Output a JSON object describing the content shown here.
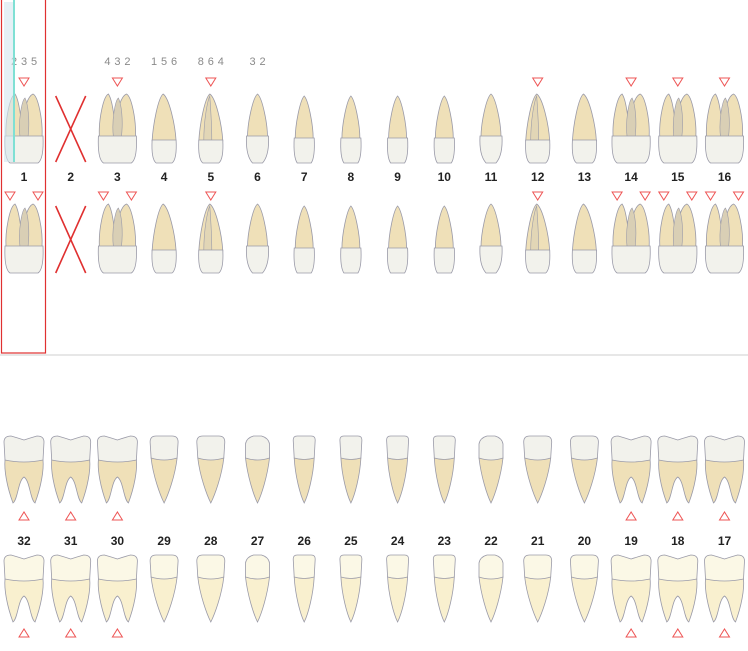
{
  "chart_title": "",
  "selected_tooth": "1",
  "missing_teeth": [
    "2"
  ],
  "colors": {
    "crown_fill": "#f2f2ec",
    "crown_fill_front": "#fbf8e6",
    "root_fill": "#efe0b8",
    "root_fill_light": "#f9f0cf",
    "outline": "#9a9aa8",
    "marker": "#ee5555",
    "missing_x": "#e03030",
    "selection": "#e03030",
    "probe_line": "#7fe0d4",
    "probe_fill": "#d3e6ee",
    "divider": "#cfcfcf",
    "probe_text": "#8a8a8a"
  },
  "upper_teeth": [
    {
      "number": "1",
      "type": "molar",
      "lingual_markers": 1,
      "buccal_markers": 2,
      "probing": [
        "2",
        "3",
        "5"
      ]
    },
    {
      "number": "2",
      "type": "molar",
      "lingual_markers": 0,
      "buccal_markers": 0,
      "probing": []
    },
    {
      "number": "3",
      "type": "molar",
      "lingual_markers": 1,
      "buccal_markers": 2,
      "probing": [
        "4",
        "3",
        "2"
      ]
    },
    {
      "number": "4",
      "type": "premolar",
      "lingual_markers": 0,
      "buccal_markers": 0,
      "probing": [
        "1",
        "5",
        "6"
      ]
    },
    {
      "number": "5",
      "type": "premolar2",
      "lingual_markers": 1,
      "buccal_markers": 1,
      "probing": [
        "8",
        "6",
        "4"
      ]
    },
    {
      "number": "6",
      "type": "canine",
      "lingual_markers": 0,
      "buccal_markers": 0,
      "probing": [
        "3",
        "2"
      ]
    },
    {
      "number": "7",
      "type": "incisor",
      "lingual_markers": 0,
      "buccal_markers": 0,
      "probing": []
    },
    {
      "number": "8",
      "type": "incisor",
      "lingual_markers": 0,
      "buccal_markers": 0,
      "probing": []
    },
    {
      "number": "9",
      "type": "incisor",
      "lingual_markers": 0,
      "buccal_markers": 0,
      "probing": []
    },
    {
      "number": "10",
      "type": "incisor",
      "lingual_markers": 0,
      "buccal_markers": 0,
      "probing": []
    },
    {
      "number": "11",
      "type": "canine",
      "lingual_markers": 0,
      "buccal_markers": 0,
      "probing": []
    },
    {
      "number": "12",
      "type": "premolar2",
      "lingual_markers": 1,
      "buccal_markers": 1,
      "probing": []
    },
    {
      "number": "13",
      "type": "premolar",
      "lingual_markers": 0,
      "buccal_markers": 0,
      "probing": []
    },
    {
      "number": "14",
      "type": "molar",
      "lingual_markers": 1,
      "buccal_markers": 2,
      "probing": []
    },
    {
      "number": "15",
      "type": "molar",
      "lingual_markers": 1,
      "buccal_markers": 2,
      "probing": []
    },
    {
      "number": "16",
      "type": "molar",
      "lingual_markers": 1,
      "buccal_markers": 2,
      "probing": []
    }
  ],
  "lower_teeth": [
    {
      "number": "32",
      "type": "molar",
      "lingual_markers": 1,
      "buccal_markers": 1
    },
    {
      "number": "31",
      "type": "molar",
      "lingual_markers": 1,
      "buccal_markers": 1
    },
    {
      "number": "30",
      "type": "molar",
      "lingual_markers": 1,
      "buccal_markers": 1
    },
    {
      "number": "29",
      "type": "premolar",
      "lingual_markers": 0,
      "buccal_markers": 0
    },
    {
      "number": "28",
      "type": "premolar",
      "lingual_markers": 0,
      "buccal_markers": 0
    },
    {
      "number": "27",
      "type": "canine",
      "lingual_markers": 0,
      "buccal_markers": 0
    },
    {
      "number": "26",
      "type": "incisor",
      "lingual_markers": 0,
      "buccal_markers": 0
    },
    {
      "number": "25",
      "type": "incisor",
      "lingual_markers": 0,
      "buccal_markers": 0
    },
    {
      "number": "24",
      "type": "incisor",
      "lingual_markers": 0,
      "buccal_markers": 0
    },
    {
      "number": "23",
      "type": "incisor",
      "lingual_markers": 0,
      "buccal_markers": 0
    },
    {
      "number": "22",
      "type": "canine",
      "lingual_markers": 0,
      "buccal_markers": 0
    },
    {
      "number": "21",
      "type": "premolar",
      "lingual_markers": 0,
      "buccal_markers": 0
    },
    {
      "number": "20",
      "type": "premolar",
      "lingual_markers": 0,
      "buccal_markers": 0
    },
    {
      "number": "19",
      "type": "molar",
      "lingual_markers": 1,
      "buccal_markers": 1
    },
    {
      "number": "18",
      "type": "molar",
      "lingual_markers": 1,
      "buccal_markers": 1
    },
    {
      "number": "17",
      "type": "molar",
      "lingual_markers": 1,
      "buccal_markers": 1
    }
  ]
}
